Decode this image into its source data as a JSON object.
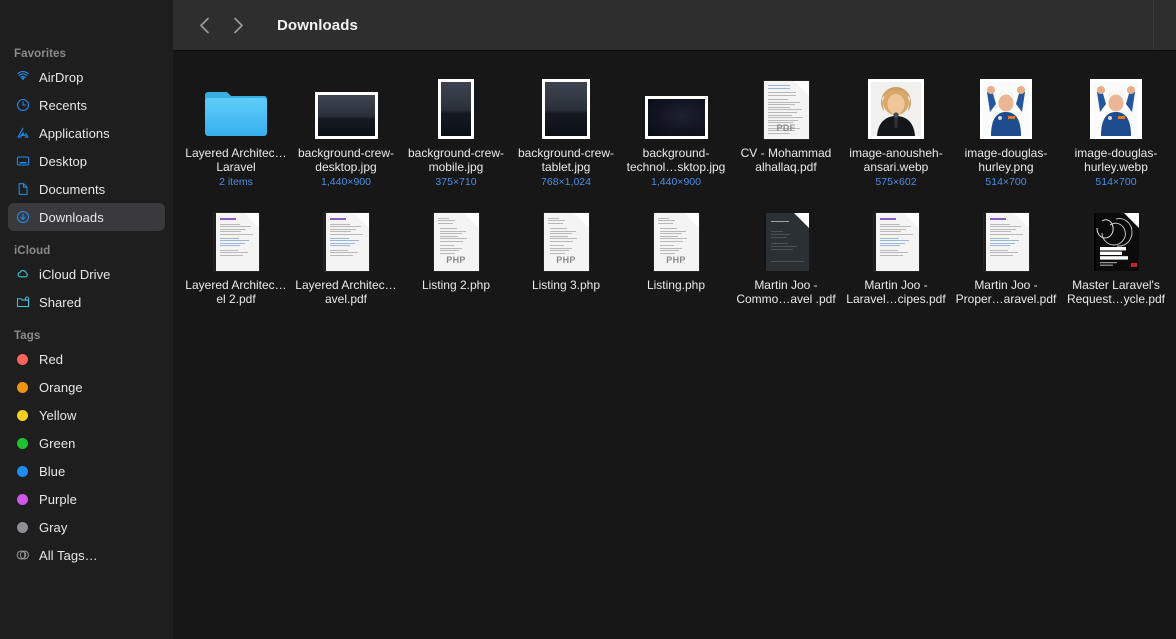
{
  "window": {
    "title": "Downloads"
  },
  "toolbar": {
    "back_label": "Back",
    "forward_label": "Forward",
    "title": "Downloads"
  },
  "sidebar": {
    "groups": [
      {
        "title": "Favorites",
        "items": [
          {
            "label": "AirDrop",
            "icon": "airdrop-icon",
            "selected": false
          },
          {
            "label": "Recents",
            "icon": "clock-icon",
            "selected": false
          },
          {
            "label": "Applications",
            "icon": "applications-icon",
            "selected": false
          },
          {
            "label": "Desktop",
            "icon": "desktop-icon",
            "selected": false
          },
          {
            "label": "Documents",
            "icon": "document-icon",
            "selected": false
          },
          {
            "label": "Downloads",
            "icon": "downloads-icon",
            "selected": true
          }
        ]
      },
      {
        "title": "iCloud",
        "items": [
          {
            "label": "iCloud Drive",
            "icon": "cloud-icon",
            "selected": false
          },
          {
            "label": "Shared",
            "icon": "shared-folder-icon",
            "selected": false
          }
        ]
      },
      {
        "title": "Tags",
        "items": [
          {
            "label": "Red",
            "icon": "tag-dot-icon",
            "color": "#f6655a",
            "selected": false
          },
          {
            "label": "Orange",
            "icon": "tag-dot-icon",
            "color": "#ee9212",
            "selected": false
          },
          {
            "label": "Yellow",
            "icon": "tag-dot-icon",
            "color": "#f5ce20",
            "selected": false
          },
          {
            "label": "Green",
            "icon": "tag-dot-icon",
            "color": "#21c231",
            "selected": false
          },
          {
            "label": "Blue",
            "icon": "tag-dot-icon",
            "color": "#1e8cf0",
            "selected": false
          },
          {
            "label": "Purple",
            "icon": "tag-dot-icon",
            "color": "#cc57e8",
            "selected": false
          },
          {
            "label": "Gray",
            "icon": "tag-dot-icon",
            "color": "#8e8e93",
            "selected": false
          },
          {
            "label": "All Tags…",
            "icon": "all-tags-icon",
            "color": "",
            "selected": false
          }
        ]
      }
    ]
  },
  "files": [
    {
      "name": "Layered Architec…Laravel",
      "meta": "2 items",
      "kind": "folder"
    },
    {
      "name": "background-crew-desktop.jpg",
      "meta": "1,440×900",
      "kind": "photo-sky-landscape"
    },
    {
      "name": "background-crew-mobile.jpg",
      "meta": "375×710",
      "kind": "photo-sky-portrait"
    },
    {
      "name": "background-crew-tablet.jpg",
      "meta": "768×1,024",
      "kind": "photo-sky-tablet"
    },
    {
      "name": "background-technol…sktop.jpg",
      "meta": "1,440×900",
      "kind": "photo-dark-landscape"
    },
    {
      "name": "CV - Mohammad alhallaq.pdf",
      "meta": "",
      "kind": "pdf-light-text"
    },
    {
      "name": "image-anousheh-ansari.webp",
      "meta": "575×602",
      "kind": "photo-portrait-woman"
    },
    {
      "name": "image-douglas-hurley.png",
      "meta": "514×700",
      "kind": "photo-portrait-astronaut"
    },
    {
      "name": "image-douglas-hurley.webp",
      "meta": "514×700",
      "kind": "photo-portrait-astronaut"
    },
    {
      "name": "Layered Architec…el 2.pdf",
      "meta": "",
      "kind": "pdf-purple-doc"
    },
    {
      "name": "Layered Architec…avel.pdf",
      "meta": "",
      "kind": "pdf-purple-doc"
    },
    {
      "name": "Listing 2.php",
      "meta": "",
      "kind": "php-file"
    },
    {
      "name": "Listing 3.php",
      "meta": "",
      "kind": "php-file"
    },
    {
      "name": "Listing.php",
      "meta": "",
      "kind": "php-file"
    },
    {
      "name": "Martin Joo - Commo…avel .pdf",
      "meta": "",
      "kind": "pdf-dark-page"
    },
    {
      "name": "Martin Joo - Laravel…cipes.pdf",
      "meta": "",
      "kind": "pdf-purple-doc"
    },
    {
      "name": "Martin Joo - Proper…aravel.pdf",
      "meta": "",
      "kind": "pdf-purple-doc"
    },
    {
      "name": "Master Laravel's Request…ycle.pdf",
      "meta": "",
      "kind": "book-cover"
    }
  ],
  "php_badge": "PDF",
  "php_label": "PHP",
  "colors": {
    "sidebar_bg": "#1e1e1e",
    "content_bg": "#171717",
    "toolbar_bg": "#2e2e2e",
    "accent_blue": "#1e8cf0",
    "meta_blue": "#4a90e8",
    "selection_gray": "#3a3a3c",
    "folder_blue": "#49c0f5"
  }
}
